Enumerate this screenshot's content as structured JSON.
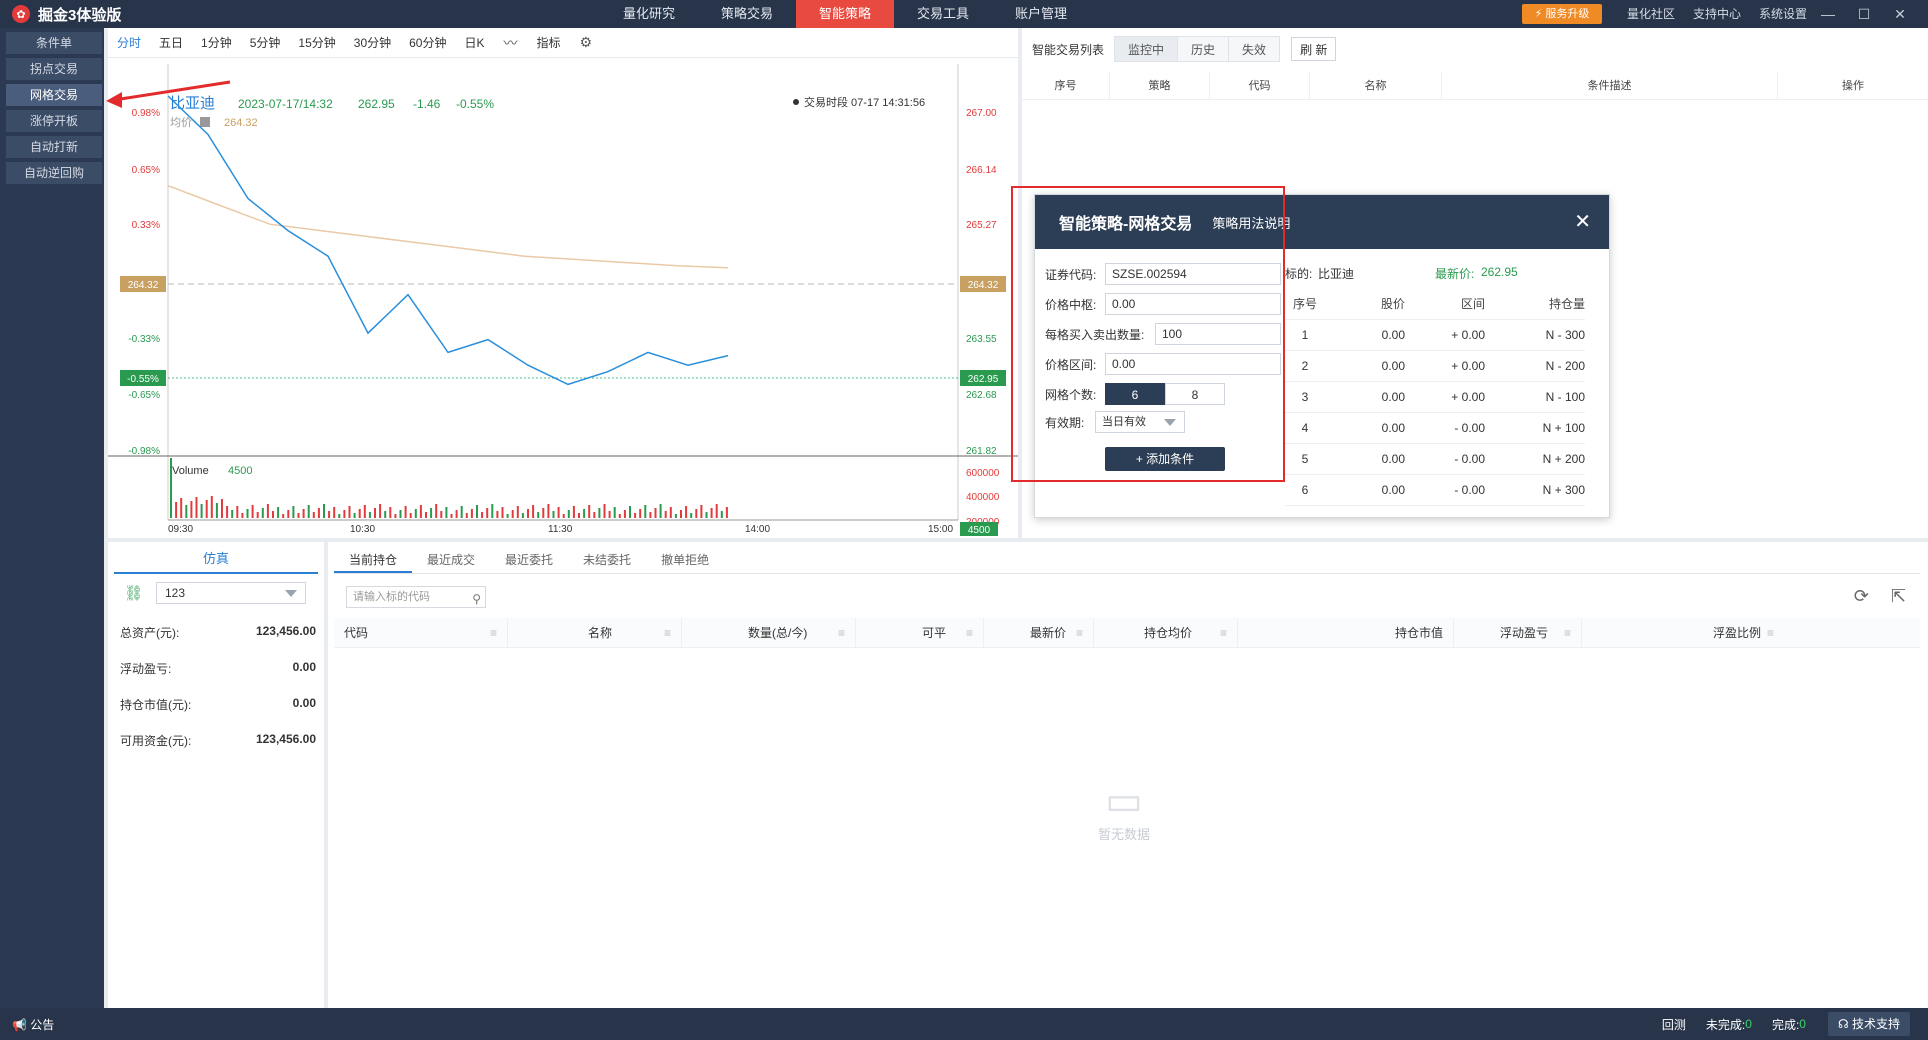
{
  "app": {
    "title": "掘金3体验版"
  },
  "topnav": [
    {
      "label": "量化研究",
      "active": false
    },
    {
      "label": "策略交易",
      "active": false
    },
    {
      "label": "智能策略",
      "active": true
    },
    {
      "label": "交易工具",
      "active": false
    },
    {
      "label": "账户管理",
      "active": false
    }
  ],
  "upgrade_label": "服务升级",
  "rightnav": [
    "量化社区",
    "支持中心",
    "系统设置"
  ],
  "sidebar": [
    {
      "label": "条件单",
      "active": false
    },
    {
      "label": "拐点交易",
      "active": false
    },
    {
      "label": "网格交易",
      "active": true
    },
    {
      "label": "涨停开板",
      "active": false
    },
    {
      "label": "自动打新",
      "active": false
    },
    {
      "label": "自动逆回购",
      "active": false
    }
  ],
  "chart_toolbar": {
    "tabs": [
      "分时",
      "五日",
      "1分钟",
      "5分钟",
      "15分钟",
      "30分钟",
      "60分钟",
      "日K"
    ],
    "indicator_label": "指标"
  },
  "chart": {
    "stock_name": "比亚迪",
    "timestamp": "2023-07-17/14:32",
    "price": "262.95",
    "change": "-1.46",
    "change_pct": "-0.55%",
    "trade_session": "交易时段 07-17 14:31:56",
    "avg_label": "均价",
    "avg_value": "264.32",
    "volume_label": "Volume",
    "volume_value": "4500",
    "prev_close": "264.32",
    "left_ticks": [
      "0.98%",
      "0.65%",
      "0.33%",
      "-0.33%",
      "-0.65%",
      "-0.98%"
    ],
    "right_ticks": [
      "267.00",
      "266.14",
      "265.27",
      "263.55",
      "262.68",
      "261.82"
    ],
    "current_pct_tag": "-0.55%",
    "current_price_tag": "262.95",
    "volume_ticks": [
      "600000",
      "400000",
      "200000"
    ],
    "volume_tag": "4500",
    "time_ticks": [
      "09:30",
      "10:30",
      "11:30",
      "14:00",
      "15:00"
    ]
  },
  "chart_data": {
    "type": "line",
    "title": "比亚迪",
    "x": [
      "09:30",
      "10:30",
      "11:30",
      "14:00",
      "15:00"
    ],
    "ylim": [
      261.82,
      267.0
    ],
    "series": [
      {
        "name": "价格",
        "values": [
          267.0,
          266.4,
          265.4,
          264.9,
          264.5,
          263.3,
          263.9,
          263.0,
          263.2,
          262.8,
          262.5,
          262.7,
          263.0,
          262.8,
          262.95
        ]
      },
      {
        "name": "均价",
        "values": [
          265.6,
          265.3,
          265.0,
          264.9,
          264.8,
          264.7,
          264.6,
          264.5,
          264.45,
          264.4,
          264.35,
          264.32
        ]
      }
    ],
    "volume_ylim": [
      0,
      600000
    ]
  },
  "trade_list": {
    "label": "智能交易列表",
    "tabs": [
      {
        "label": "监控中",
        "active": true
      },
      {
        "label": "历史",
        "active": false
      },
      {
        "label": "失效",
        "active": false
      }
    ],
    "refresh_label": "刷 新",
    "columns": [
      "序号",
      "策略",
      "代码",
      "名称",
      "条件描述",
      "操作"
    ]
  },
  "dialog": {
    "title": "智能策略-网格交易",
    "help": "策略用法说明",
    "fields": {
      "code_label": "证券代码:",
      "code_value": "SZSE.002594",
      "center_label": "价格中枢:",
      "center_value": "0.00",
      "qty_label": "每格买入卖出数量:",
      "qty_value": "100",
      "range_label": "价格区间:",
      "range_value": "0.00",
      "grid_count_label": "网格个数:",
      "grid_count_options": [
        "6",
        "8"
      ],
      "validity_label": "有效期:",
      "validity_value": "当日有效"
    },
    "add_button": "+ 添加条件",
    "target_label": "标的:",
    "target_value": "比亚迪",
    "latest_label": "最新价:",
    "latest_value": "262.95",
    "grid_columns": [
      "序号",
      "股价",
      "区间",
      "持仓量"
    ],
    "grid_rows": [
      {
        "idx": "1",
        "price": "0.00",
        "range": "+ 0.00",
        "pos": "N - 300"
      },
      {
        "idx": "2",
        "price": "0.00",
        "range": "+ 0.00",
        "pos": "N - 200"
      },
      {
        "idx": "3",
        "price": "0.00",
        "range": "+ 0.00",
        "pos": "N - 100"
      },
      {
        "idx": "4",
        "price": "0.00",
        "range": "- 0.00",
        "pos": "N + 100"
      },
      {
        "idx": "5",
        "price": "0.00",
        "range": "- 0.00",
        "pos": "N + 200"
      },
      {
        "idx": "6",
        "price": "0.00",
        "range": "- 0.00",
        "pos": "N + 300"
      }
    ]
  },
  "account": {
    "tab": "仿真",
    "account_id": "123",
    "rows": [
      {
        "label": "总资产(元):",
        "value": "123,456.00"
      },
      {
        "label": "浮动盈亏:",
        "value": "0.00"
      },
      {
        "label": "持仓市值(元):",
        "value": "0.00"
      },
      {
        "label": "可用资金(元):",
        "value": "123,456.00"
      }
    ]
  },
  "positions": {
    "tabs": [
      {
        "label": "当前持仓",
        "active": true
      },
      {
        "label": "最近成交",
        "active": false
      },
      {
        "label": "最近委托",
        "active": false
      },
      {
        "label": "未结委托",
        "active": false
      },
      {
        "label": "撤单拒绝",
        "active": false
      }
    ],
    "search_placeholder": "请输入标的代码",
    "columns": [
      "代码",
      "名称",
      "数量(总/今)",
      "可平",
      "最新价",
      "持仓均价",
      "持仓市值",
      "浮动盈亏",
      "浮盈比例"
    ],
    "empty_text": "暂无数据"
  },
  "status": {
    "notice": "公告",
    "backtest": "回测",
    "unfinished_label": "未完成:",
    "unfinished_value": "0",
    "finished_label": "完成:",
    "finished_value": "0",
    "support": "技术支持"
  },
  "colors": {
    "accent": "#e84a3f",
    "blue": "#2a7fd4",
    "green": "#3aa55d",
    "navy": "#2c3e55",
    "annotation_red": "#e32b2b"
  }
}
